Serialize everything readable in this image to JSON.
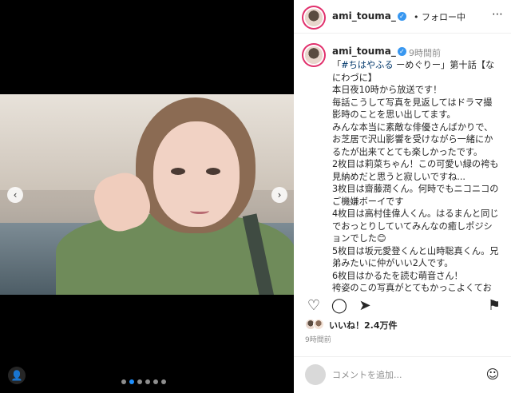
{
  "post": {
    "username": "ami_touma_",
    "follow_status": "フォロー中",
    "time_ago": "9時間前",
    "caption_lines": [
      "「#ちはやふる ーめぐりー」第十話【な",
      "にわづに】",
      "本日夜10時から放送です！",
      "毎話こうして写真を見返してはドラマ撮",
      "影時のことを思い出してます。",
      "みんな本当に素敵な俳優さんばかりで、",
      "お芝居で沢山影響を受けながら一緒にか",
      "るたが出来てとても楽しかったです。",
      "2枚目は莉菜ちゃん！この可愛い緑の袴も",
      "見納めだと思うと寂しいですね...",
      "3枚目は齋藤潤くん。何時でもニコニコの",
      "ご機嫌ボーイです",
      "4枚目は高村佳偉人くん。はるまんと同じ",
      "でおっとりしていてみんなの癒しポジシ",
      "ョンでした😊",
      "5枚目は坂元愛登くんと山時聡真くん。兄",
      "弟みたいに仲がいい2人です。",
      "6枚目はかるたを読む萌音さん！",
      "袴姿のこの写真がとてもかっこよくてお",
      "気に入りです"
    ],
    "likes_text": "いいね！2.4万件",
    "posted_time": "9時間前",
    "comment_placeholder": "コメントを追加...",
    "carousel": {
      "total": 6,
      "active_index": 1
    }
  },
  "icons": {
    "more": "more-options-icon",
    "like": "heart-icon",
    "comment": "comment-icon",
    "share": "share-icon",
    "save": "bookmark-icon",
    "emoji": "emoji-icon",
    "prev": "chevron-left-icon",
    "next": "chevron-right-icon",
    "tag": "user-tag-icon"
  },
  "colors": {
    "accent": "#3897f0",
    "story_ring": "#e1306c",
    "hashtag": "#00376b"
  }
}
